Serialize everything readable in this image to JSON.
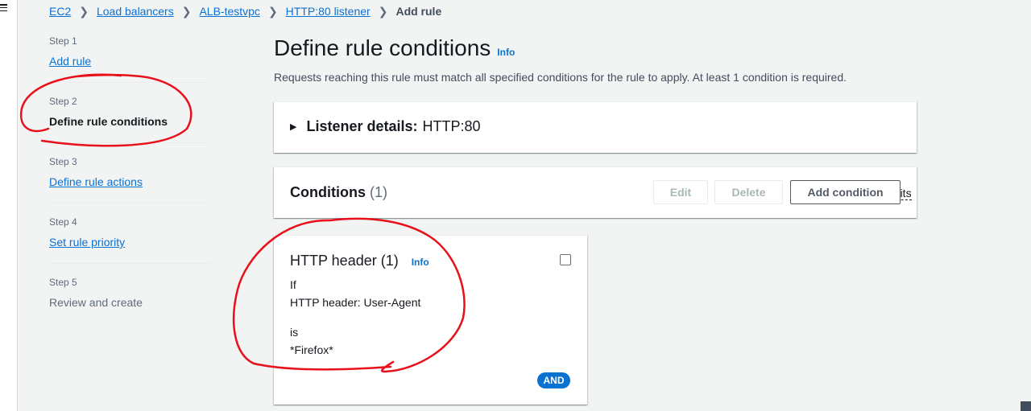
{
  "breadcrumb": {
    "items": [
      "EC2",
      "Load balancers",
      "ALB-testvpc",
      "HTTP:80 listener"
    ],
    "current": "Add rule"
  },
  "steps": [
    {
      "number": "Step 1",
      "label": "Add rule",
      "state": "link"
    },
    {
      "number": "Step 2",
      "label": "Define rule conditions",
      "state": "current"
    },
    {
      "number": "Step 3",
      "label": "Define rule actions",
      "state": "link"
    },
    {
      "number": "Step 4",
      "label": "Set rule priority",
      "state": "link"
    },
    {
      "number": "Step 5",
      "label": "Review and create",
      "state": "disabled"
    }
  ],
  "page": {
    "title": "Define rule conditions",
    "info": "Info",
    "description": "Requests reaching this rule must match all specified conditions for the rule to apply. At least 1 condition is required."
  },
  "listener": {
    "label": "Listener details:",
    "value": "HTTP:80"
  },
  "conditions": {
    "title": "Conditions",
    "count": "(1)",
    "rule_limits": "Rule limits",
    "edit": "Edit",
    "delete": "Delete",
    "add": "Add condition"
  },
  "condition_card": {
    "title": "HTTP header (1)",
    "info": "Info",
    "if": "If",
    "header": "HTTP header: User-Agent",
    "is": "is",
    "value": "*Firefox*",
    "badge": "AND"
  },
  "colors": {
    "link": "#0972d3",
    "annotation": "#e8101a",
    "background": "#f2f3f3"
  }
}
